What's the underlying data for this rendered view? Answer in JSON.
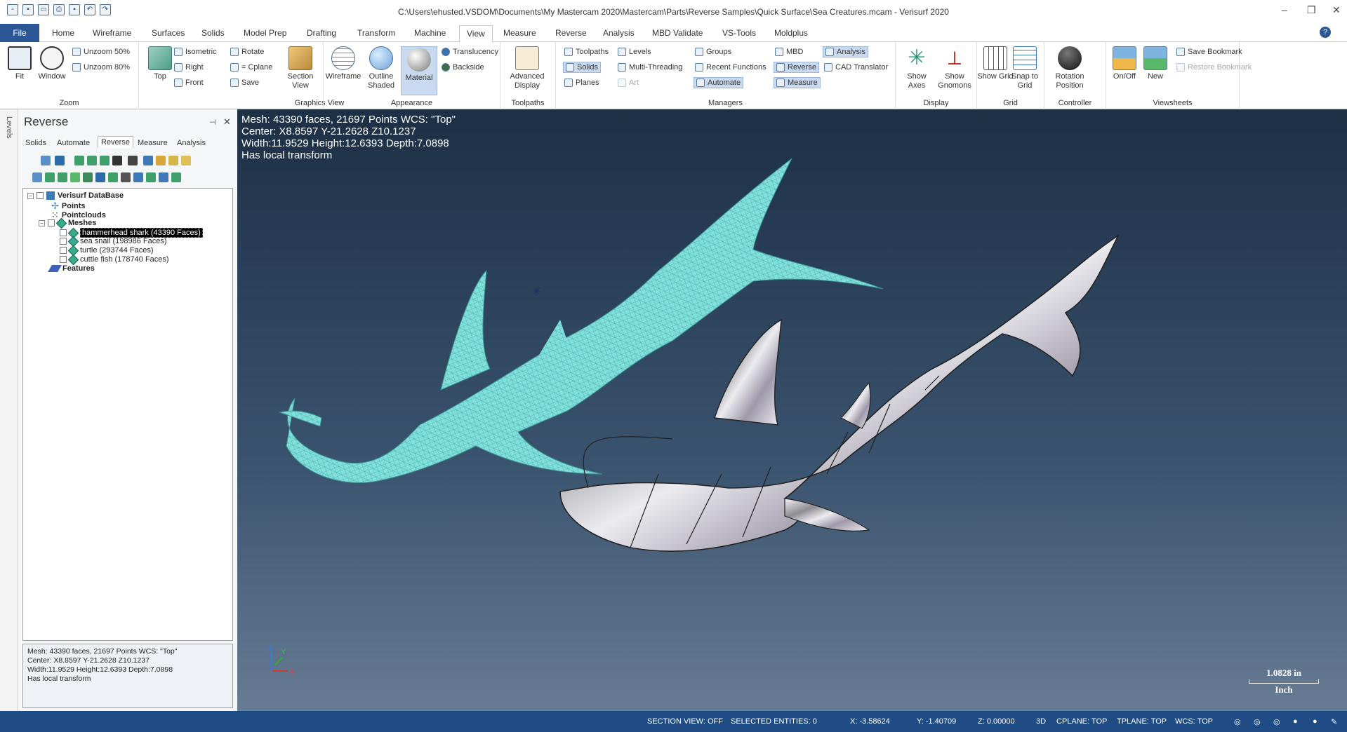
{
  "title_bar": {
    "title": "C:\\Users\\ehusted.VSDOM\\Documents\\My Mastercam 2020\\Mastercam\\Parts\\Reverse Samples\\Quick Surface\\Sea Creatures.mcam - Verisurf 2020"
  },
  "tabs": [
    "File",
    "Home",
    "Wireframe",
    "Surfaces",
    "Solids",
    "Model Prep",
    "Drafting",
    "Transform",
    "Machine",
    "View",
    "Measure",
    "Reverse",
    "Analysis",
    "MBD Validate",
    "VS-Tools",
    "Moldplus"
  ],
  "ribbon": {
    "zoom": {
      "label": "Zoom",
      "fit": "Fit",
      "window": "Window",
      "unzoom50": "Unzoom 50%",
      "unzoom80": "Unzoom 80%"
    },
    "graphics_view": {
      "label": "Graphics View",
      "top": "Top",
      "isometric": "Isometric",
      "right": "Right",
      "front": "Front",
      "rotate": "Rotate",
      "cplane": "= Cplane",
      "save": "Save",
      "section_view": "Section View"
    },
    "appearance": {
      "label": "Appearance",
      "wireframe": "Wireframe",
      "outline_shaded": "Outline Shaded",
      "material": "Material",
      "translucency": "Translucency",
      "backside": "Backside"
    },
    "toolpaths": {
      "label": "Toolpaths",
      "advanced_display": "Advanced Display"
    },
    "managers": {
      "label": "Managers",
      "toolpaths": "Toolpaths",
      "solids": "Solids",
      "planes": "Planes",
      "levels": "Levels",
      "multi_threading": "Multi-Threading",
      "art": "Art",
      "groups": "Groups",
      "recent_functions": "Recent Functions",
      "automate": "Automate",
      "mbd": "MBD",
      "reverse": "Reverse",
      "measure": "Measure",
      "analysis": "Analysis",
      "cad_translator": "CAD Translator"
    },
    "display": {
      "label": "Display",
      "show_axes": "Show Axes",
      "show_gnomons": "Show Gnomons"
    },
    "grid": {
      "label": "Grid",
      "show_grid": "Show Grid",
      "snap_to_grid": "Snap to Grid"
    },
    "controller": {
      "label": "Controller",
      "rotation_position": "Rotation Position"
    },
    "viewsheets": {
      "label": "Viewsheets",
      "on_off": "On/Off",
      "new": "New",
      "save_bookmark": "Save Bookmark",
      "restore_bookmark": "Restore Bookmark"
    }
  },
  "left_strip": {
    "label": "Levels"
  },
  "panel": {
    "title": "Reverse",
    "tabs": [
      "Solids",
      "Automate",
      "Reverse",
      "Measure",
      "Analysis"
    ],
    "tree": {
      "root": "Verisurf DataBase",
      "points": "Points",
      "pointclouds": "Pointclouds",
      "meshes": "Meshes",
      "mesh_items": [
        "hammerhead shark (43390 Faces)",
        "sea snail (198986 Faces)",
        "turtle (293744 Faces)",
        "cuttle fish (178740 Faces)"
      ],
      "features": "Features"
    },
    "info": [
      "Mesh: 43390 faces, 21697 Points  WCS: \"Top\"",
      "Center: X8.8597 Y-21.2628 Z10.1237",
      "Width:11.9529 Height:12.6393 Depth:7.0898",
      "Has local transform"
    ]
  },
  "viewport": {
    "info": [
      "Mesh: 43390 faces, 21697 Points  WCS: \"Top\"",
      "Center: X8.8597 Y-21.2628 Z10.1237",
      "Width:11.9529 Height:12.6393 Depth:7.0898",
      "Has local transform"
    ],
    "scale_value": "1.0828 in",
    "scale_unit": "Inch",
    "axis_z": "Z",
    "axis_y": "Y",
    "axis_x": "X"
  },
  "status_bar": {
    "section_view": "SECTION VIEW: OFF",
    "selected": "SELECTED ENTITIES: 0",
    "x": "X:  -3.58624",
    "y": "Y:  -1.40709",
    "z": "Z:  0.00000",
    "mode": "3D",
    "cplane": "CPLANE: TOP",
    "tplane": "TPLANE: TOP",
    "wcs": "WCS: TOP"
  },
  "colors": {
    "accent": "#2b5797",
    "mesh": "#7fe0dc",
    "viewport_top": "#1c2f45",
    "status": "#1f4c85"
  }
}
